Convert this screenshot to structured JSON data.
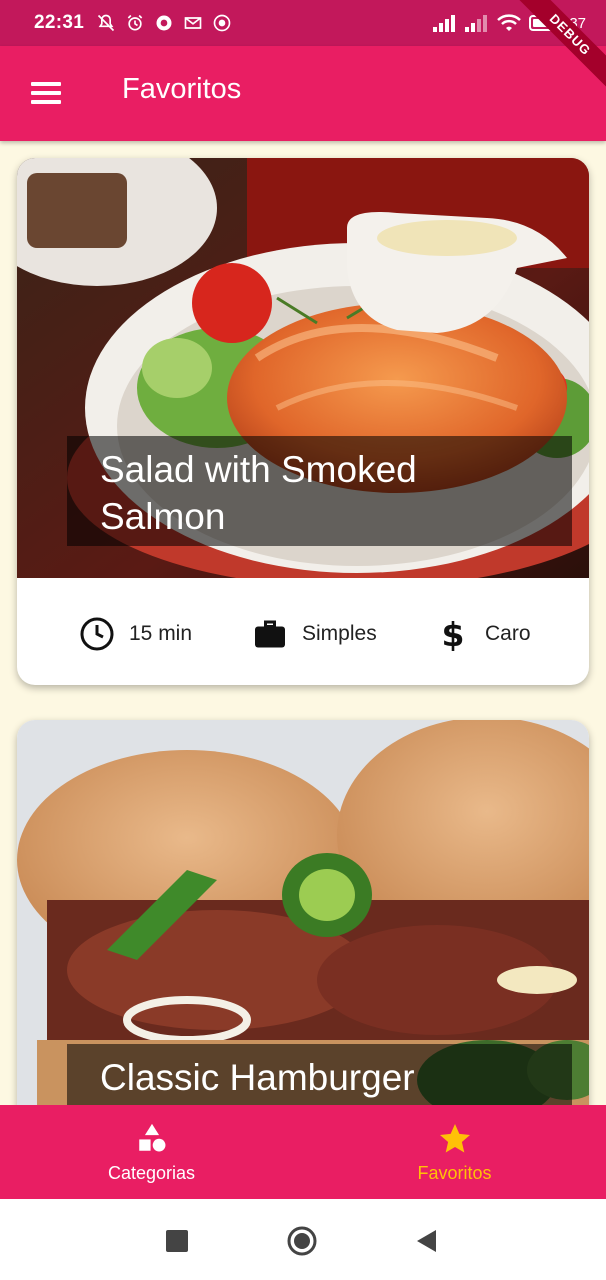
{
  "status_bar": {
    "time": "22:31",
    "battery_text": "37"
  },
  "debug_banner": "DEBUG",
  "app_bar": {
    "title": "Favoritos",
    "menu_icon": "menu-icon"
  },
  "meals": [
    {
      "title": "Salad with Smoked Salmon",
      "duration": "15 min",
      "complexity": "Simples",
      "cost": "Caro"
    },
    {
      "title": "Classic Hamburger"
    }
  ],
  "bottom_nav": {
    "items": [
      {
        "label": "Categorias",
        "icon": "category-icon",
        "active": false
      },
      {
        "label": "Favoritos",
        "icon": "star-icon",
        "active": true
      }
    ]
  },
  "colors": {
    "primary": "#e91e63",
    "status_bar": "#c2185b",
    "accent": "#ffc107",
    "background": "#fdf8e2"
  }
}
